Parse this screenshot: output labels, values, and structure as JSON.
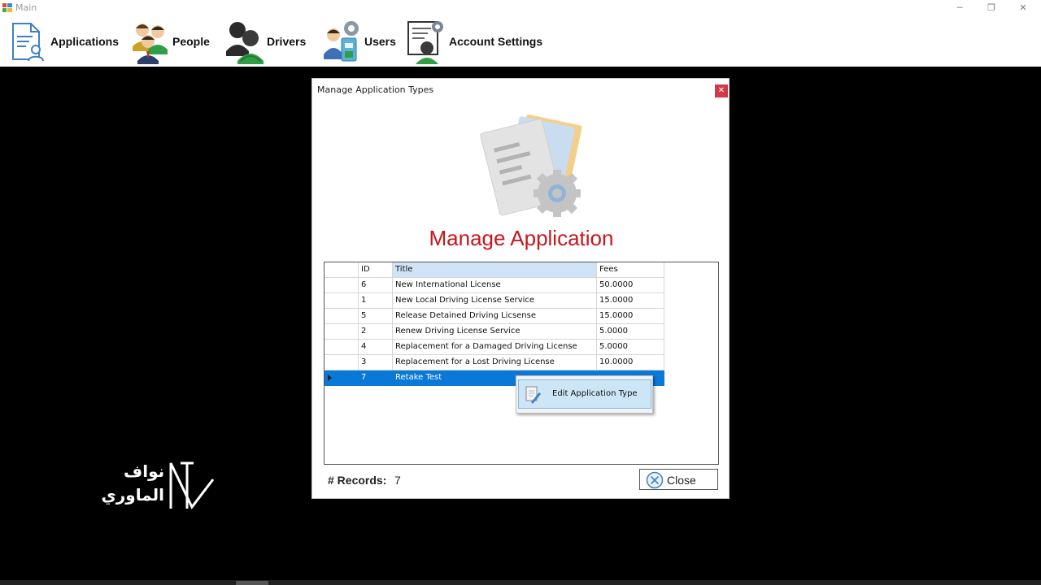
{
  "window": {
    "title": "Main",
    "minimize_glyph": "─",
    "restore_glyph": "❐",
    "close_glyph": "✕"
  },
  "menu": {
    "items": [
      {
        "label": "Applications",
        "icon": "applications-icon"
      },
      {
        "label": "People",
        "icon": "people-icon"
      },
      {
        "label": "Drivers",
        "icon": "drivers-icon"
      },
      {
        "label": "Users",
        "icon": "users-icon"
      },
      {
        "label": "Account Settings",
        "icon": "account-settings-icon"
      }
    ]
  },
  "dialog": {
    "title": "Manage Application Types",
    "close_glyph": "✕",
    "heading": "Manage Application",
    "heading_color": "#c8161d",
    "hero_icon": "application-types-icon",
    "grid": {
      "columns": [
        "",
        "ID",
        "Title",
        "Fees"
      ],
      "rows": [
        {
          "id": "6",
          "title": "New International License",
          "fees": "50.0000"
        },
        {
          "id": "1",
          "title": "New Local Driving License Service",
          "fees": "15.0000"
        },
        {
          "id": "5",
          "title": "Release Detained Driving Licsense",
          "fees": "15.0000"
        },
        {
          "id": "2",
          "title": "Renew Driving License Service",
          "fees": "5.0000"
        },
        {
          "id": "4",
          "title": "Replacement for a Damaged Driving License",
          "fees": "5.0000"
        },
        {
          "id": "3",
          "title": "Replacement for a Lost Driving License",
          "fees": "10.0000"
        },
        {
          "id": "7",
          "title": "Retake Test",
          "fees": "",
          "selected": true
        }
      ],
      "selection_color": "#0a78d7"
    },
    "context_menu": {
      "items": [
        {
          "label": "Edit Application Type",
          "icon": "edit-document-icon"
        }
      ]
    },
    "records_label": "# Records:",
    "records_value": "7",
    "close_button_label": "Close"
  },
  "watermark": {
    "line1": "نواف",
    "line2": "الماوري",
    "logo": "nm-monogram-logo"
  }
}
